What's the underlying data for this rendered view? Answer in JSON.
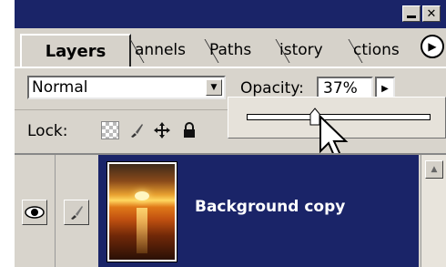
{
  "window": {
    "minimize_icon": "minimize-icon",
    "close_label": "✕"
  },
  "tabs": [
    {
      "label": "Layers",
      "active": true
    },
    {
      "label": "annels",
      "active": false
    },
    {
      "label": "Paths",
      "active": false
    },
    {
      "label": "istory",
      "active": false
    },
    {
      "label": "ctions",
      "active": false
    }
  ],
  "panel_menu_icon": "right-arrow-circle-icon",
  "blend_mode": {
    "value": "Normal",
    "dropdown_icon": "chevron-down-icon"
  },
  "opacity": {
    "label": "Opacity:",
    "value": "37%",
    "fraction": 0.37,
    "button_icon": "chevron-right-icon"
  },
  "lock": {
    "label": "Lock:",
    "icons": [
      "transparency-lock-icon",
      "brush-lock-icon",
      "move-lock-icon",
      "padlock-icon"
    ]
  },
  "layers": [
    {
      "name": "Background copy",
      "visible": true,
      "selected": true,
      "thumbnail": "sunset-over-water"
    }
  ],
  "colors": {
    "title_bar": "#1a2468",
    "selected_row": "#1a2468",
    "panel_bg": "#d8d4cc"
  }
}
